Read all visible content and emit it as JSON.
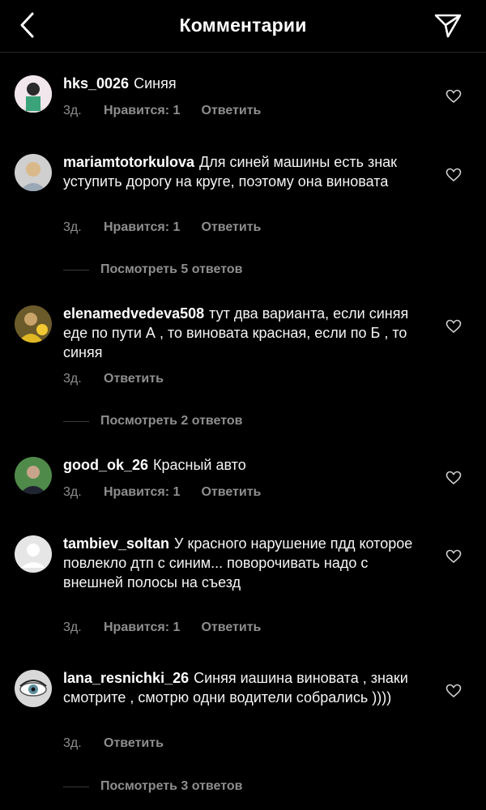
{
  "header": {
    "title": "Комментарии"
  },
  "comments": [
    {
      "username": "hks_0026",
      "text": "Синяя",
      "time": "3д.",
      "likes": "Нравится: 1",
      "reply": "Ответить"
    },
    {
      "username": "mariamtotorkulova",
      "text": "Для синей машины есть знак уступить дорогу на круге, поэтому она виновата",
      "time": "3д.",
      "likes": "Нравится: 1",
      "reply": "Ответить",
      "view_replies": "Посмотреть 5 ответов"
    },
    {
      "username": "elenamedvedeva508",
      "text": "тут два варианта, если синяя еде по пути А , то виновата красная, если по Б , то синяя",
      "time": "3д.",
      "reply": "Ответить",
      "view_replies": "Посмотреть 2 ответов"
    },
    {
      "username": "good_ok_26",
      "text": "Красный авто",
      "time": "3д.",
      "likes": "Нравится: 1",
      "reply": "Ответить"
    },
    {
      "username": "tambiev_soltan",
      "text": "У красного нарушение пдд которое повлекло дтп с синим... поворочивать надо с внешней полосы на съезд",
      "time": "3д.",
      "likes": "Нравится: 1",
      "reply": "Ответить"
    },
    {
      "username": "lana_resnichki_26",
      "text": "Синяя иашина виновата , знаки смотрите , смотрю одни водители собрались ))))",
      "time": "3д.",
      "reply": "Ответить",
      "view_replies": "Посмотреть 3 ответов"
    }
  ]
}
